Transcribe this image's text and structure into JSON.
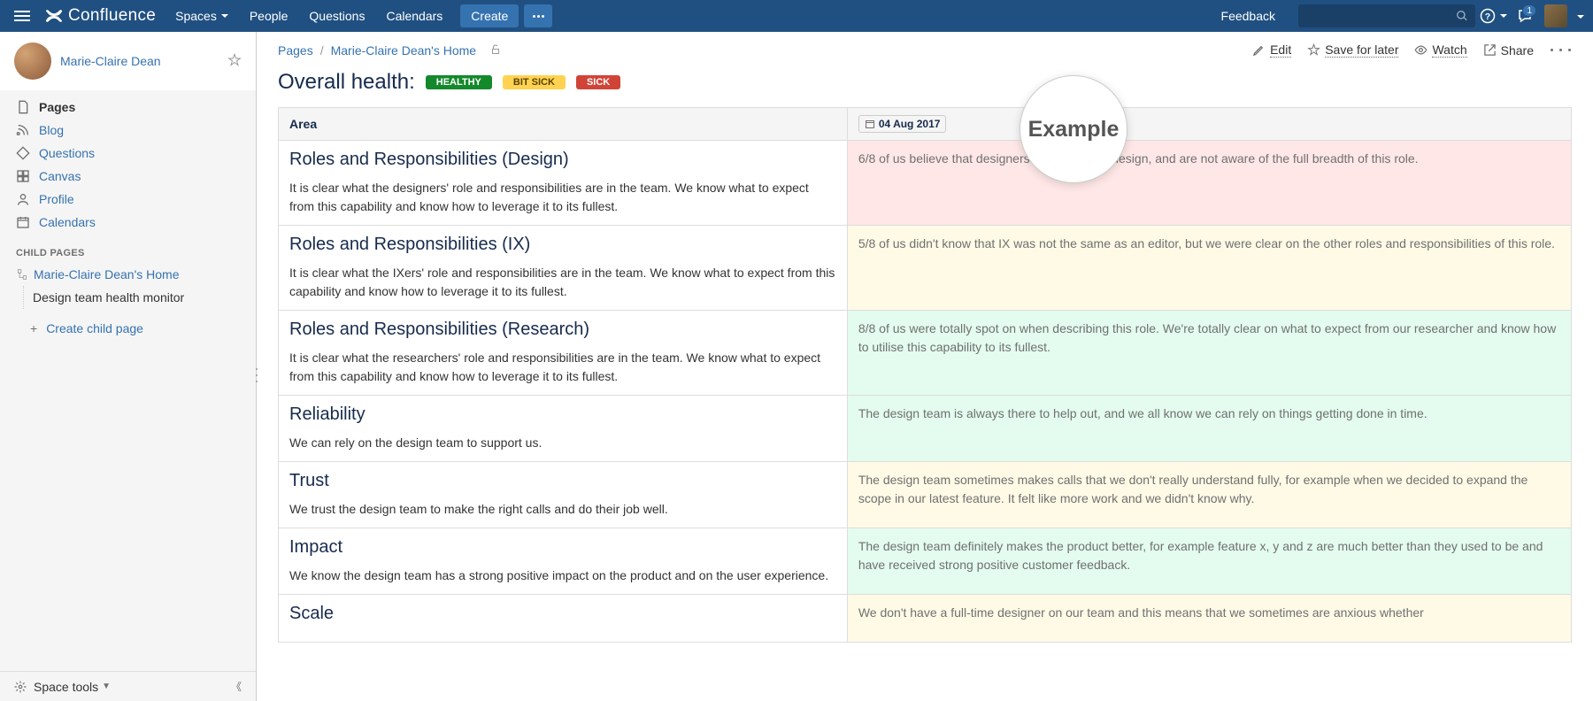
{
  "header": {
    "logo": "Confluence",
    "nav": {
      "spaces": "Spaces",
      "people": "People",
      "questions": "Questions",
      "calendars": "Calendars"
    },
    "create": "Create",
    "feedback": "Feedback",
    "notification_count": "1"
  },
  "sidebar": {
    "user_name": "Marie-Claire Dean",
    "nav": {
      "pages": "Pages",
      "blog": "Blog",
      "questions": "Questions",
      "canvas": "Canvas",
      "profile": "Profile",
      "calendars": "Calendars"
    },
    "child_pages_label": "CHILD PAGES",
    "tree": {
      "home": "Marie-Claire Dean's Home",
      "child": "Design team health monitor"
    },
    "create_child": "Create child page",
    "space_tools": "Space tools"
  },
  "breadcrumb": {
    "pages": "Pages",
    "home": "Marie-Claire Dean's Home"
  },
  "actions": {
    "edit": "Edit",
    "save": "Save for later",
    "watch": "Watch",
    "share": "Share"
  },
  "title_row": {
    "title": "Overall health:",
    "healthy": "HEALTHY",
    "bit_sick": "BIT SICK",
    "sick": "SICK"
  },
  "table": {
    "area_header": "Area",
    "date": "04 Aug 2017",
    "rows": [
      {
        "title": "Roles and Responsibilities (Design)",
        "desc": "It is clear what the designers' role and responsibilities are in the team. We know what to expect from this capability and know how to leverage it to its fullest.",
        "status": "6/8 of us believe that designers only do visual design, and are not aware of the full breadth of this role.",
        "color": "bg-red"
      },
      {
        "title": "Roles and Responsibilities (IX)",
        "desc": "It is clear what the IXers' role and responsibilities are in the team. We know what to expect from this capability and know how to leverage it to its fullest.",
        "status": "5/8 of us didn't know that IX was not the same as an editor, but we were clear on the other roles and responsibilities of this role.",
        "color": "bg-yellow"
      },
      {
        "title": "Roles and Responsibilities (Research)",
        "desc": "It is clear what the researchers' role and responsibilities are in the team. We know what to expect from this capability and know how to leverage it to its fullest.",
        "status": "8/8 of us were totally spot on when describing this role. We're totally clear on what to expect from our researcher and know how to utilise this capability to its fullest.",
        "color": "bg-green"
      },
      {
        "title": "Reliability",
        "desc": "We can rely on the design team to support us.",
        "status": "The design team is always there to help out, and we all know we can rely on things getting done in time.",
        "color": "bg-green"
      },
      {
        "title": "Trust",
        "desc": "We trust the design team to make the right calls and do their job well.",
        "status": "The design team sometimes makes calls that we don't really understand fully, for example when we decided to expand the scope in our latest feature. It felt like more work and we didn't know why.",
        "color": "bg-yellow"
      },
      {
        "title": "Impact",
        "desc": "We know the design team has a strong positive impact on the product and on the user experience.",
        "status": "The design team definitely makes the product better, for example feature x, y and z are much better than they used to be and have received strong positive customer feedback.",
        "color": "bg-green"
      },
      {
        "title": "Scale",
        "desc": "",
        "status": "We don't have a full-time designer on our team and this means that we sometimes are anxious whether",
        "color": "bg-yellow"
      }
    ]
  },
  "example_label": "Example"
}
